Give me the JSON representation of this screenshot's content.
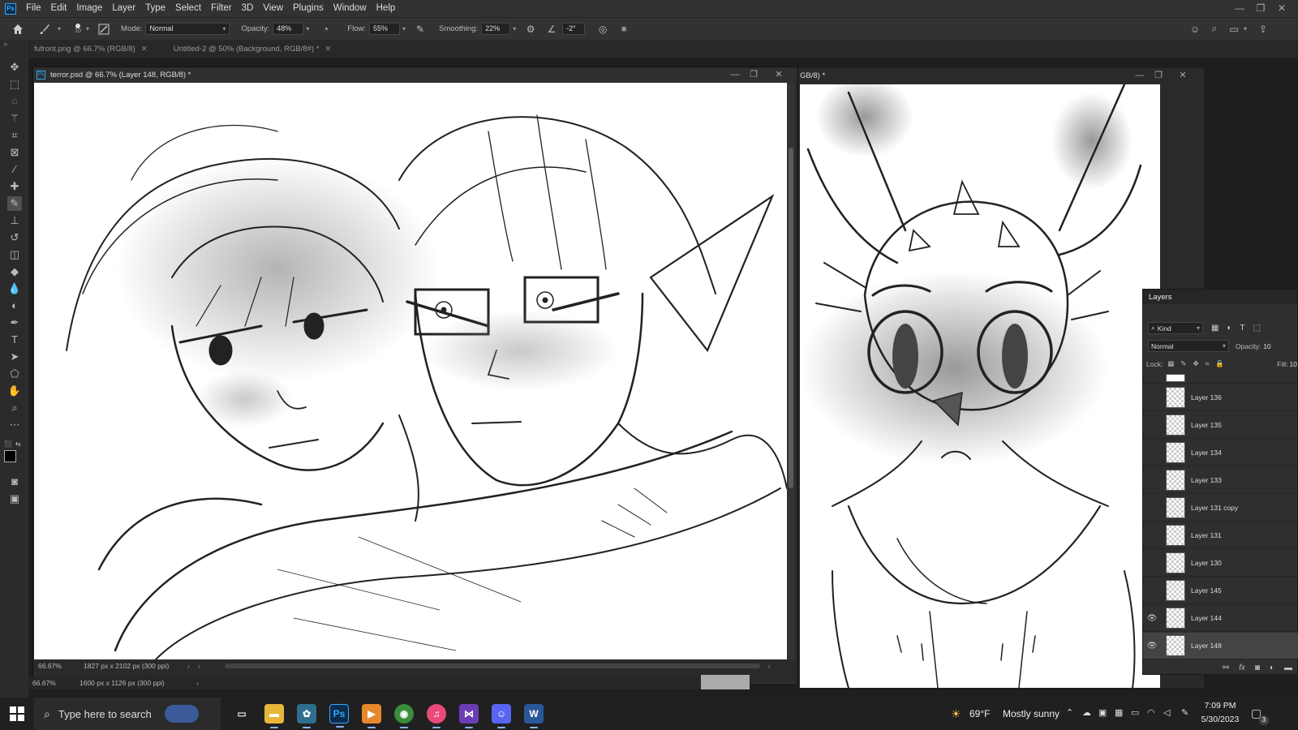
{
  "app": {
    "logo_text": "Ps"
  },
  "menu": [
    "File",
    "Edit",
    "Image",
    "Layer",
    "Type",
    "Select",
    "Filter",
    "3D",
    "View",
    "Plugins",
    "Window",
    "Help"
  ],
  "options": {
    "brush_size": "10",
    "mode_label": "Mode:",
    "mode_value": "Normal",
    "opacity_label": "Opacity:",
    "opacity_value": "48%",
    "flow_label": "Flow:",
    "flow_value": "55%",
    "smoothing_label": "Smoothing:",
    "smoothing_value": "22%",
    "angle_value": "-2°"
  },
  "doc_tabs": [
    {
      "label": "fufront.png @ 66.7% (RGB/8)"
    },
    {
      "label": "Untitled-2 @ 50% (Background, RGB/8#) *"
    }
  ],
  "main_window": {
    "title": "terror.psd @ 66.7% (Layer 148, RGB/8) *",
    "zoom": "66.67%",
    "doc_size": "1827 px x 2102 px (300 ppi)"
  },
  "second_window": {
    "title_fragment": "GB/8) *"
  },
  "bottom_status": {
    "zoom": "66.67%",
    "doc_size": "1600 px x 1126 px (300 ppi)"
  },
  "layers_panel": {
    "title": "Layers",
    "filter_kind": "Kind",
    "blend_mode": "Normal",
    "opacity_label": "Opacity:",
    "opacity_value": "10",
    "lock_label": "Lock:",
    "fill_label": "Fill:",
    "fill_value": "10",
    "layers": [
      {
        "name": "Layer 136",
        "visible": false,
        "selected": false
      },
      {
        "name": "Layer 135",
        "visible": false,
        "selected": false
      },
      {
        "name": "Layer 134",
        "visible": false,
        "selected": false
      },
      {
        "name": "Layer 133",
        "visible": false,
        "selected": false
      },
      {
        "name": "Layer 131 copy",
        "visible": false,
        "selected": false
      },
      {
        "name": "Layer 131",
        "visible": false,
        "selected": false
      },
      {
        "name": "Layer 130",
        "visible": false,
        "selected": false
      },
      {
        "name": "Layer 145",
        "visible": false,
        "selected": false
      },
      {
        "name": "Layer 144",
        "visible": true,
        "selected": false
      },
      {
        "name": "Layer 148",
        "visible": true,
        "selected": true
      }
    ]
  },
  "taskbar": {
    "search_placeholder": "Type here to search",
    "weather_temp": "69°F",
    "weather_desc": "Mostly sunny",
    "time": "7:09 PM",
    "date": "5/30/2023",
    "notification_count": "3",
    "apps": [
      "task-view",
      "file-explorer",
      "app-generic",
      "photoshop",
      "media-player",
      "chrome",
      "itunes",
      "visual-studio",
      "discord",
      "word"
    ]
  },
  "colors": {
    "ps_accent": "#31a8ff",
    "panel_bg": "#2f2f2f",
    "menubar_bg": "#323232",
    "taskbar_bg": "#202020"
  }
}
